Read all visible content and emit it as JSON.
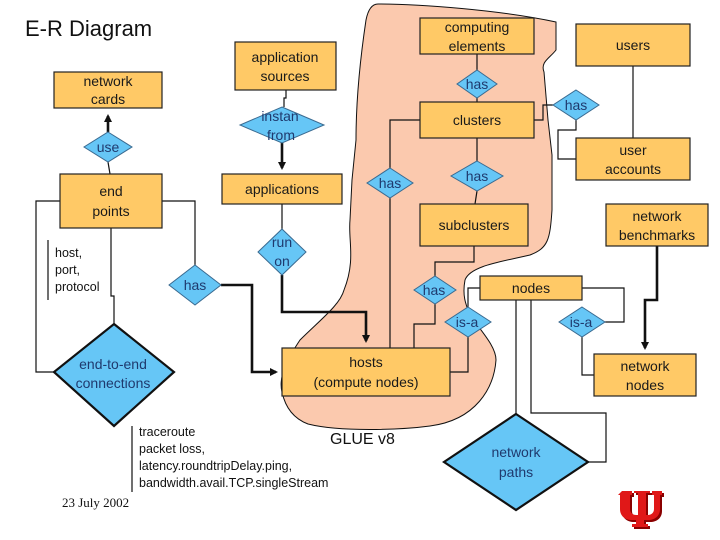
{
  "title": "E-R Diagram",
  "colors": {
    "entity_fill": "#ffc966",
    "relationship_fill": "#66c6f6",
    "glue_region_fill": "#fbc9ae",
    "logo_red": "#e01818"
  },
  "entities": {
    "network_cards": [
      "network",
      "cards"
    ],
    "application_sources": [
      "application",
      "sources"
    ],
    "end_points": [
      "end",
      "points"
    ],
    "applications": [
      "applications"
    ],
    "computing_elements": [
      "computing",
      "elements"
    ],
    "users": [
      "users"
    ],
    "clusters": [
      "clusters"
    ],
    "user_accounts": [
      "user",
      "accounts"
    ],
    "subclusters": [
      "subclusters"
    ],
    "network_benchmarks": [
      "network",
      "benchmarks"
    ],
    "nodes": [
      "nodes"
    ],
    "hosts": [
      "hosts",
      "(compute nodes)"
    ],
    "network_nodes": [
      "network",
      "nodes"
    ]
  },
  "relationships": {
    "use": [
      "use"
    ],
    "instan_from": [
      "instan",
      "from"
    ],
    "run_on": [
      "run",
      "on"
    ],
    "has_endpoints": [
      "has"
    ],
    "end_to_end": [
      "end-to-end",
      "connections"
    ],
    "has_ce_clusters": [
      "has"
    ],
    "has_clusters_accounts": [
      "has"
    ],
    "has_clusters_hosts": [
      "has"
    ],
    "has_clusters_subclusters": [
      "has"
    ],
    "has_subclusters_hosts": [
      "has"
    ],
    "isa_hosts": [
      "is-a"
    ],
    "isa_network_nodes": [
      "is-a"
    ],
    "network_paths": [
      "network",
      "paths"
    ]
  },
  "notes": {
    "endpoint_attrs": [
      "host,",
      "port,",
      "protocol"
    ],
    "metrics": [
      "traceroute",
      "packet loss,",
      "latency.roundtripDelay.ping,",
      "bandwidth.avail.TCP.singleStream"
    ],
    "date": "23 July 2002",
    "glue_label": "GLUE v8"
  },
  "logo": "Indiana University trident"
}
